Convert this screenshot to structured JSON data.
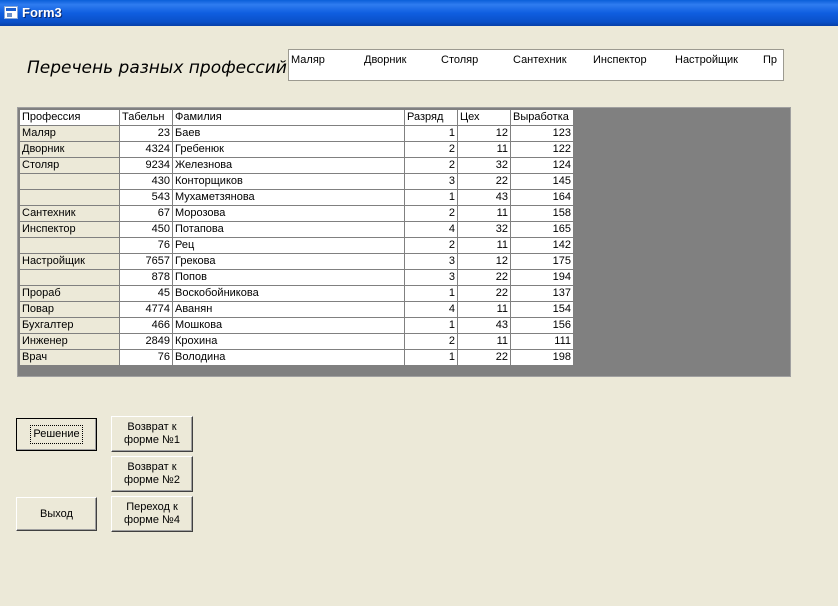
{
  "window": {
    "title": "Form3"
  },
  "heading": "Перечень разных профессий",
  "professions_list": [
    "Маляр",
    "Дворник",
    "Столяр",
    "Сантехник",
    "Инспектор",
    "Настройщик",
    "Пр"
  ],
  "table": {
    "headers": [
      "Профессия",
      "Табельн",
      "Фамилия",
      "Разряд",
      "Цех",
      "Выработка"
    ],
    "rows": [
      [
        "Маляр",
        "23",
        "Баев",
        "1",
        "12",
        "123"
      ],
      [
        "Дворник",
        "4324",
        "Гребенюк",
        "2",
        "11",
        "122"
      ],
      [
        "Столяр",
        "9234",
        "Железнова",
        "2",
        "32",
        "124"
      ],
      [
        "",
        "430",
        "Конторщиков",
        "3",
        "22",
        "145"
      ],
      [
        "",
        "543",
        "Мухаметзянова",
        "1",
        "43",
        "164"
      ],
      [
        "Сантехник",
        "67",
        "Морозова",
        "2",
        "11",
        "158"
      ],
      [
        "Инспектор",
        "450",
        "Потапова",
        "4",
        "32",
        "165"
      ],
      [
        "",
        "76",
        "Рец",
        "2",
        "11",
        "142"
      ],
      [
        "Настройщик",
        "7657",
        "Грекова",
        "3",
        "12",
        "175"
      ],
      [
        "",
        "878",
        "Попов",
        "3",
        "22",
        "194"
      ],
      [
        "Прораб",
        "45",
        "Воскобойникова",
        "1",
        "22",
        "137"
      ],
      [
        "Повар",
        "4774",
        "Аванян",
        "4",
        "11",
        "154"
      ],
      [
        "Бухгалтер",
        "466",
        "Мошкова",
        "1",
        "43",
        "156"
      ],
      [
        "Инженер",
        "2849",
        "Крохина",
        "2",
        "11",
        "111"
      ],
      [
        "Врач",
        "76",
        "Володина",
        "1",
        "22",
        "198"
      ]
    ]
  },
  "buttons": {
    "solve": "Решение",
    "back1": "Возврат к\nформе №1",
    "back2": "Возврат к\nформе №2",
    "exit": "Выход",
    "goto4": "Переход к\nформе №4"
  }
}
